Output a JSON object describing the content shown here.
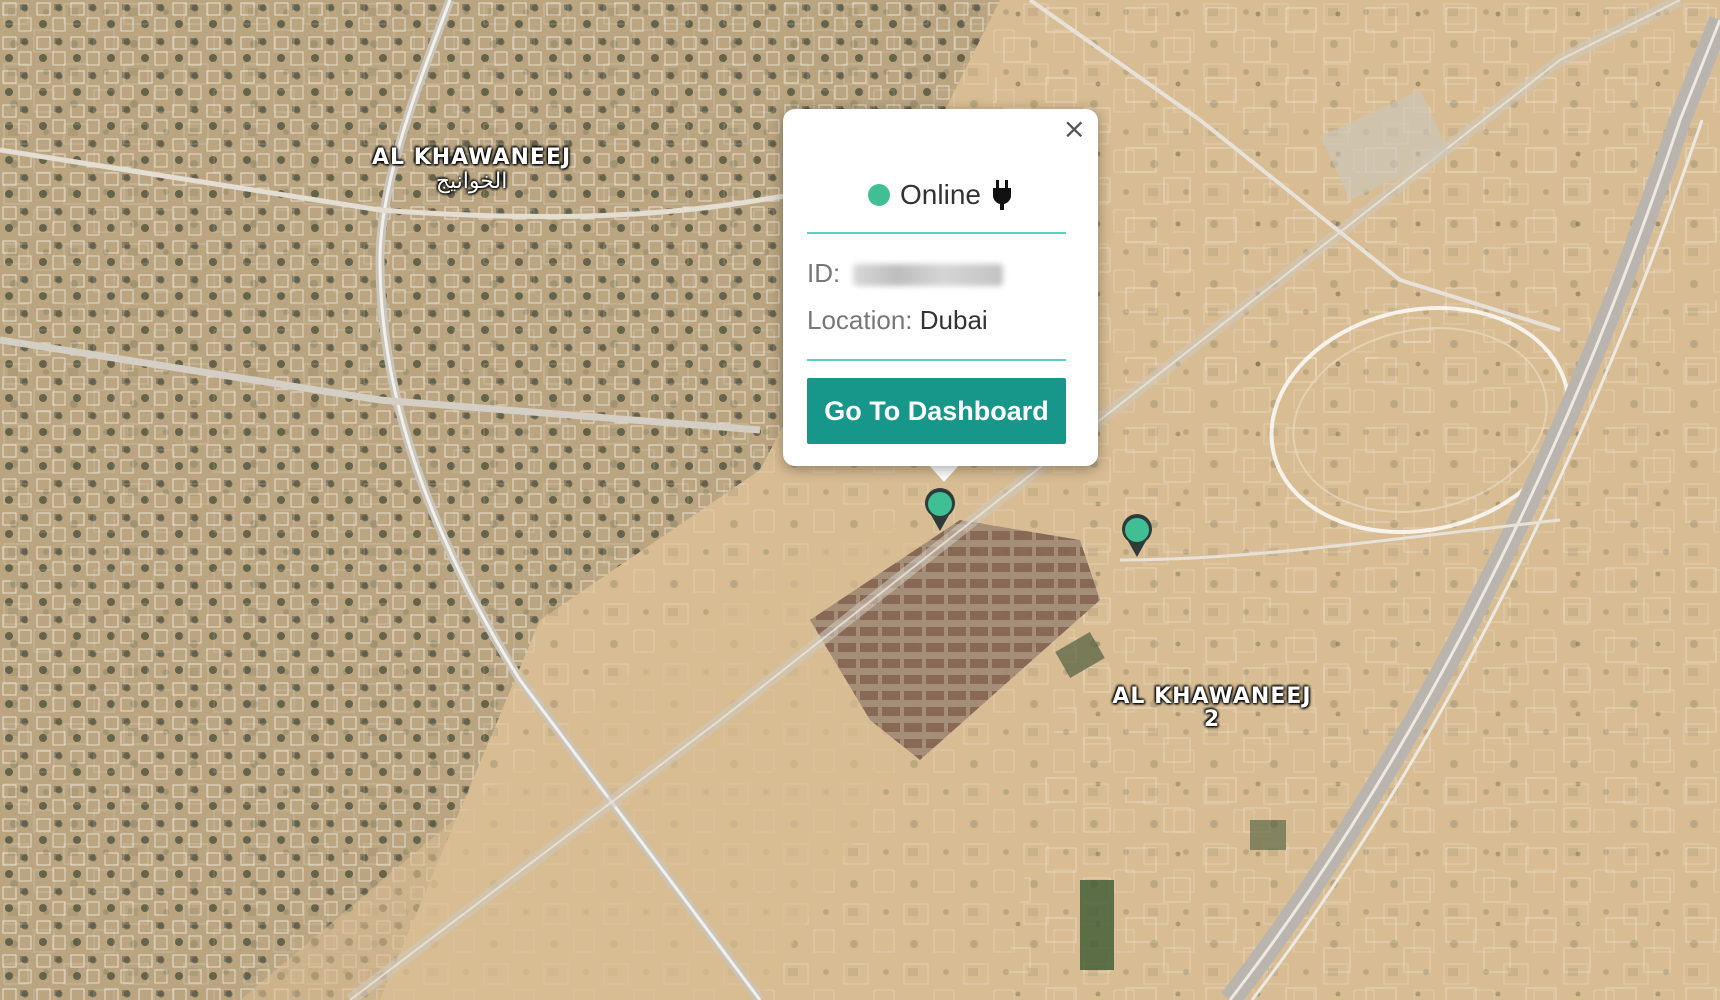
{
  "map": {
    "labels": [
      {
        "name": "AL KHAWANEEJ",
        "arabic": "الخوانيج"
      },
      {
        "name": "AL KHAWANEEJ 2"
      }
    ],
    "marker_color": "#40bf94"
  },
  "popup": {
    "close_icon": "×",
    "status": {
      "label": "Online",
      "dot_color": "#40bf94",
      "icon": "plug-icon"
    },
    "id_label": "ID:",
    "id_value_redacted": true,
    "location_label": "Location:",
    "location_value": "Dubai",
    "button_label": "Go To Dashboard",
    "accent_color": "#16978a"
  }
}
